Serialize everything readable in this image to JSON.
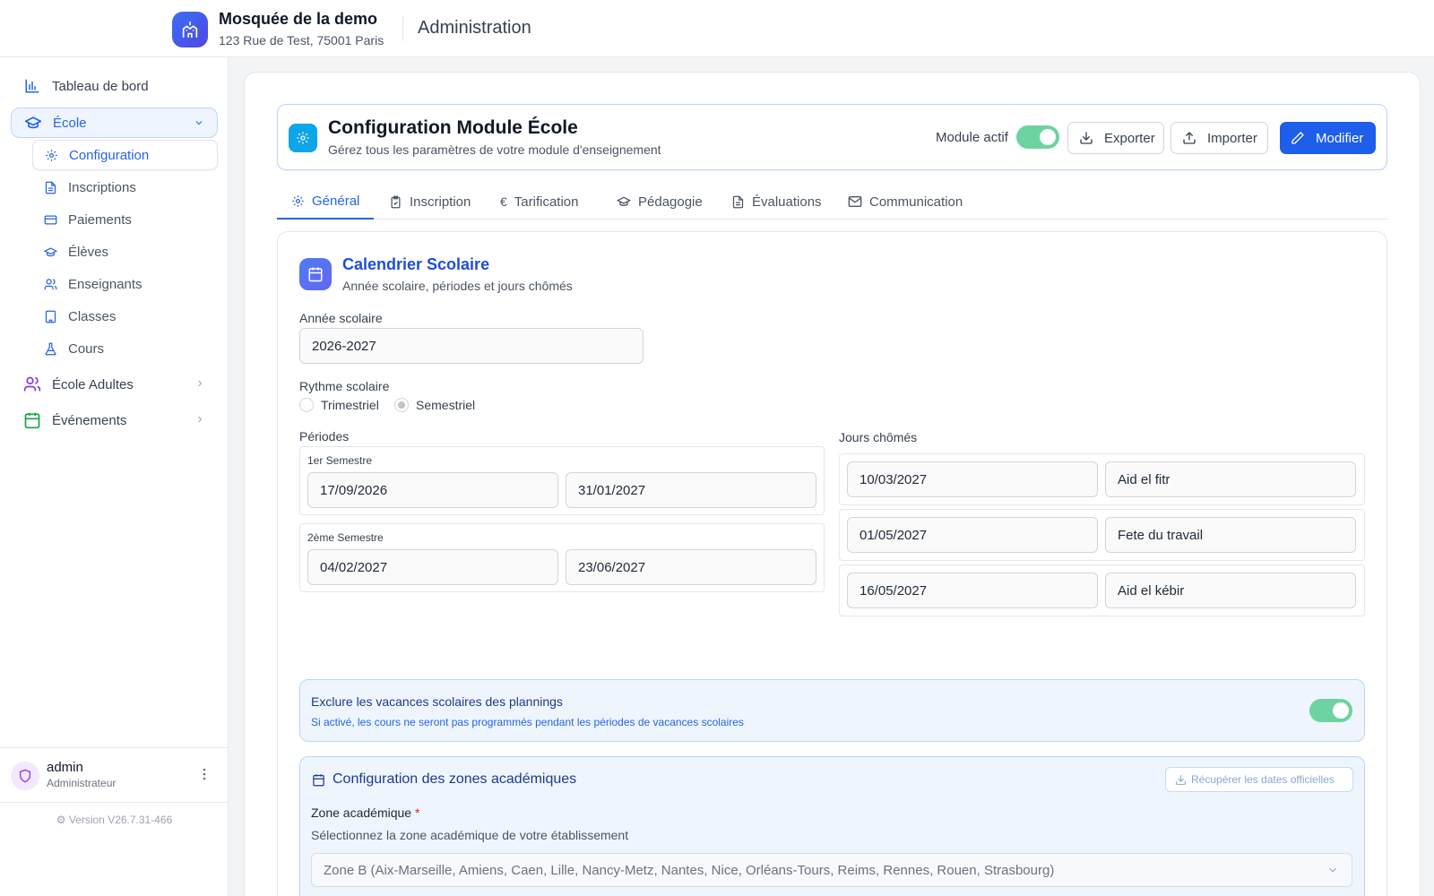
{
  "header": {
    "org_name": "Mosquée de la demo",
    "org_address": "123 Rue de Test, 75001 Paris",
    "section_title": "Administration"
  },
  "sidebar": {
    "items": [
      {
        "label": "Tableau de bord",
        "icon": "bar-chart-icon"
      },
      {
        "label": "École",
        "icon": "graduation-cap-icon",
        "expanded": true
      },
      {
        "label": "École Adultes",
        "icon": "users-icon"
      },
      {
        "label": "Événements",
        "icon": "calendar-icon"
      }
    ],
    "subitems": [
      {
        "label": "Configuration",
        "icon": "gear-icon"
      },
      {
        "label": "Inscriptions",
        "icon": "document-icon"
      },
      {
        "label": "Paiements",
        "icon": "credit-card-icon"
      },
      {
        "label": "Élèves",
        "icon": "graduation-cap-icon"
      },
      {
        "label": "Enseignants",
        "icon": "users-icon"
      },
      {
        "label": "Classes",
        "icon": "building-icon"
      },
      {
        "label": "Cours",
        "icon": "flask-icon"
      }
    ],
    "user": {
      "name": "admin",
      "role": "Administrateur"
    },
    "version": "Version V26.7.31-466"
  },
  "module": {
    "title": "Configuration Module École",
    "subtitle": "Gérez tous les paramètres de votre module d'enseignement",
    "active_label": "Module actif",
    "active": true,
    "export_label": "Exporter",
    "import_label": "Importer",
    "edit_label": "Modifier"
  },
  "tabs": [
    {
      "label": "Général",
      "icon": "gear-icon",
      "active": true
    },
    {
      "label": "Inscription",
      "icon": "clipboard-icon"
    },
    {
      "label": "Tarification",
      "icon": "euro-icon"
    },
    {
      "label": "Pédagogie",
      "icon": "graduation-cap-icon"
    },
    {
      "label": "Évaluations",
      "icon": "document-icon"
    },
    {
      "label": "Communication",
      "icon": "mail-icon"
    }
  ],
  "calendar": {
    "title": "Calendrier Scolaire",
    "subtitle": "Année scolaire, périodes et jours chômés",
    "year_label": "Année scolaire",
    "year_value": "2026-2027",
    "rhythm_label": "Rythme scolaire",
    "rhythm_options": [
      "Trimestriel",
      "Semestriel"
    ],
    "rhythm_selected": "Semestriel",
    "periods_label": "Périodes",
    "periods": [
      {
        "name": "1er Semestre",
        "start": "17/09/2026",
        "end": "31/01/2027"
      },
      {
        "name": "2ème Semestre",
        "start": "04/02/2027",
        "end": "23/06/2027"
      }
    ],
    "holidays_label": "Jours chômés",
    "holidays": [
      {
        "date": "10/03/2027",
        "name": "Aid el fitr"
      },
      {
        "date": "01/05/2027",
        "name": "Fete du travail"
      },
      {
        "date": "16/05/2027",
        "name": "Aid el kébir"
      }
    ]
  },
  "exclude": {
    "title": "Exclure les vacances scolaires des plannings",
    "subtitle": "Si activé, les cours ne seront pas programmés pendant les périodes de vacances scolaires",
    "enabled": true
  },
  "zones": {
    "title": "Configuration des zones académiques",
    "fetch_label": "Récupérer les dates officielles",
    "zone_label": "Zone académique",
    "required_mark": "*",
    "zone_help": "Sélectionnez la zone académique de votre établissement",
    "zone_value": "Zone B (Aix-Marseille, Amiens, Caen, Lille, Nancy-Metz, Nantes, Nice, Orléans-Tours, Reims, Rennes, Rouen, Strasbourg)"
  },
  "colors": {
    "primary": "#1d5eea",
    "toggle_on": "#6dd3a0",
    "accent_blue": "#2563eb"
  }
}
